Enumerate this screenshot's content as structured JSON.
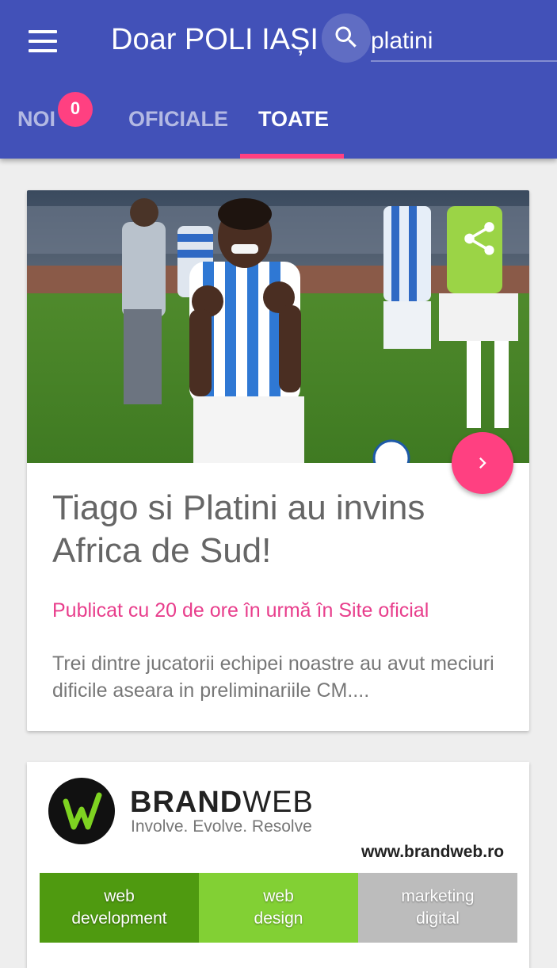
{
  "appbar": {
    "title": "Doar POLI IAȘI",
    "search_value": "platini",
    "colors": {
      "primary": "#4251b8",
      "accent": "#ff4081"
    }
  },
  "tabs": [
    {
      "label": "NOI",
      "badge": "0",
      "active": false
    },
    {
      "label": "OFICIALE",
      "active": false
    },
    {
      "label": "TOATE",
      "active": true
    }
  ],
  "article": {
    "image_description_icon": "share-icon",
    "title": "Tiago si Platini au invins Africa de Sud!",
    "meta": "Publicat cu 20 de ore în urmă în Site oficial",
    "excerpt": "Trei dintre jucatorii echipei noastre au avut meciuri dificile aseara in preliminariile CM...."
  },
  "ad": {
    "brand_bold": "BRAND",
    "brand_light": "WEB",
    "slogan": "Involve. Evolve. Resolve",
    "url": "www.brandweb.ro",
    "blocks": [
      {
        "line1": "web",
        "line2": "development"
      },
      {
        "line1": "web",
        "line2": "design"
      },
      {
        "line1": "marketing",
        "line2": "digital"
      }
    ]
  }
}
